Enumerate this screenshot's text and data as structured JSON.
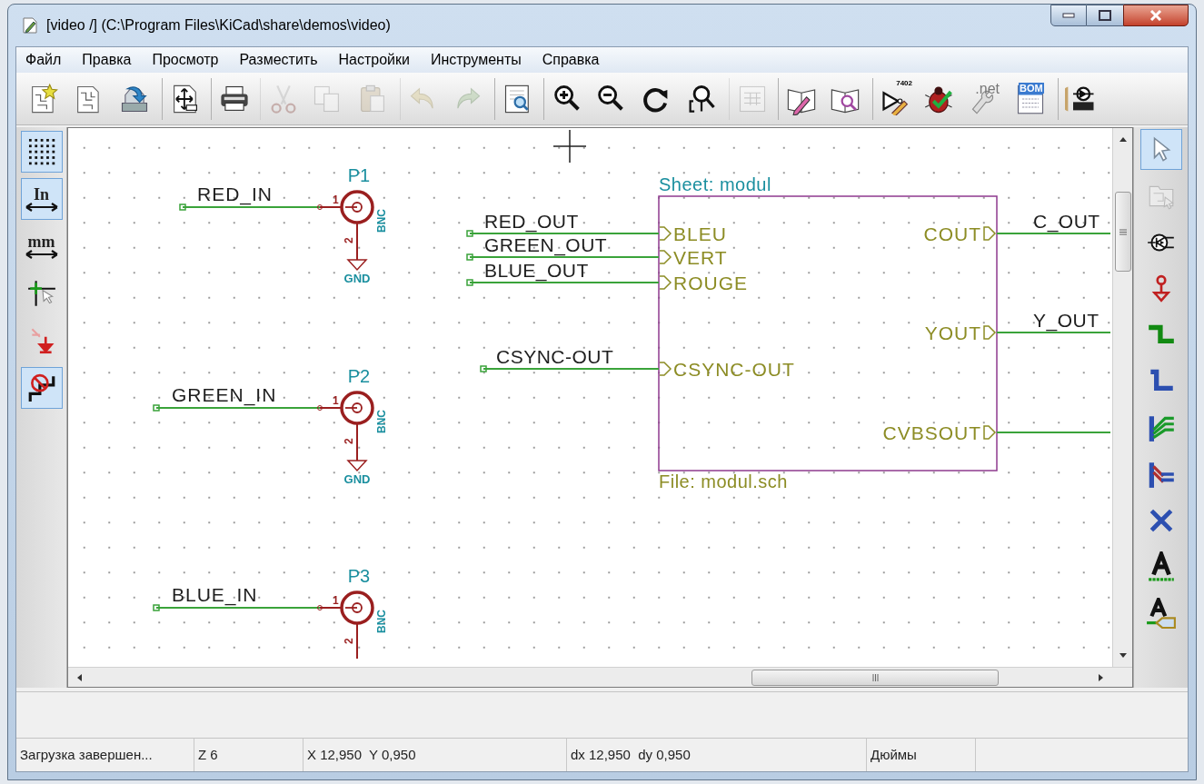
{
  "window": {
    "title": "[video /] (C:\\Program Files\\KiCad\\share\\demos\\video)"
  },
  "menu": [
    "Файл",
    "Правка",
    "Просмотр",
    "Разместить",
    "Настройки",
    "Инструменты",
    "Справка"
  ],
  "toolbar": [
    {
      "kind": "new",
      "disabled": false,
      "separator_before": false
    },
    {
      "kind": "open",
      "disabled": false,
      "separator_before": false
    },
    {
      "kind": "save",
      "disabled": false,
      "separator_before": false
    },
    {
      "kind": "page",
      "disabled": false,
      "separator_before": true
    },
    {
      "kind": "print",
      "disabled": false,
      "separator_before": true
    },
    {
      "kind": "cut",
      "disabled": true,
      "separator_before": true
    },
    {
      "kind": "copy",
      "disabled": true,
      "separator_before": false
    },
    {
      "kind": "paste",
      "disabled": true,
      "separator_before": false
    },
    {
      "kind": "undo",
      "disabled": true,
      "separator_before": true
    },
    {
      "kind": "redo",
      "disabled": true,
      "separator_before": false
    },
    {
      "kind": "preview",
      "disabled": false,
      "separator_before": true
    },
    {
      "kind": "zoom_in",
      "disabled": false,
      "separator_before": true
    },
    {
      "kind": "zoom_out",
      "disabled": false,
      "separator_before": false
    },
    {
      "kind": "redraw",
      "disabled": false,
      "separator_before": false
    },
    {
      "kind": "zoom_fit",
      "disabled": false,
      "separator_before": false
    },
    {
      "kind": "hierarchy",
      "disabled": true,
      "separator_before": true
    },
    {
      "kind": "lib_edit",
      "disabled": false,
      "separator_before": true
    },
    {
      "kind": "lib_browse",
      "disabled": false,
      "separator_before": false
    },
    {
      "kind": "annotate",
      "disabled": false,
      "separator_before": true,
      "text": "7402"
    },
    {
      "kind": "erc",
      "disabled": false,
      "separator_before": false
    },
    {
      "kind": "netlist",
      "disabled": false,
      "separator_before": false,
      "text": ".net"
    },
    {
      "kind": "bom",
      "disabled": false,
      "separator_before": false,
      "text": "BOM"
    },
    {
      "kind": "pcb",
      "disabled": false,
      "separator_before": true
    }
  ],
  "left_toolbar": [
    {
      "kind": "grid",
      "selected": true
    },
    {
      "kind": "units",
      "selected": true,
      "text": "In"
    },
    {
      "kind": "units",
      "selected": false,
      "text": "mm"
    },
    {
      "kind": "cursor",
      "selected": false
    },
    {
      "kind": "pins",
      "selected": false
    },
    {
      "kind": "bus",
      "selected": true
    }
  ],
  "right_toolbar": [
    {
      "kind": "select",
      "selected": true,
      "disabled": false
    },
    {
      "kind": "hier_nav",
      "selected": false,
      "disabled": true
    },
    {
      "kind": "component",
      "selected": false,
      "disabled": false
    },
    {
      "kind": "power",
      "selected": false,
      "disabled": false
    },
    {
      "kind": "wire",
      "selected": false,
      "disabled": false
    },
    {
      "kind": "bus",
      "selected": false,
      "disabled": false
    },
    {
      "kind": "wire_entry",
      "selected": false,
      "disabled": false
    },
    {
      "kind": "bus_entry",
      "selected": false,
      "disabled": false
    },
    {
      "kind": "no_connect",
      "selected": false,
      "disabled": false
    },
    {
      "kind": "label",
      "selected": false,
      "disabled": false
    },
    {
      "kind": "global_label",
      "selected": false,
      "disabled": false
    }
  ],
  "schematic": {
    "connectors": [
      {
        "ref": "P1",
        "net": "RED_IN",
        "pin1": "1",
        "pin2": "2",
        "value": "BNC",
        "power": "GND"
      },
      {
        "ref": "P2",
        "net": "GREEN_IN",
        "pin1": "1",
        "pin2": "2",
        "value": "BNC",
        "power": "GND"
      },
      {
        "ref": "P3",
        "net": "BLUE_IN",
        "pin1": "1",
        "pin2": "2",
        "value": "BNC"
      }
    ],
    "sheet": {
      "name": "Sheet: modul",
      "file": "File: modul.sch",
      "left_pins": [
        {
          "name": "BLEU",
          "net": "RED_OUT"
        },
        {
          "name": "VERT",
          "net": "GREEN_OUT"
        },
        {
          "name": "ROUGE",
          "net": "BLUE_OUT"
        },
        {
          "name": "CSYNC-OUT",
          "net": "CSYNC-OUT"
        }
      ],
      "right_pins": [
        {
          "name": "COUT",
          "net": "C_OUT"
        },
        {
          "name": "YOUT",
          "net": "Y_OUT"
        },
        {
          "name": "CVBSOUT"
        }
      ]
    }
  },
  "status_bar": [
    "Загрузка завершен...",
    "Z 6",
    "X 12,950  Y 0,950",
    "dx 12,950  dy 0,950",
    "Дюймы"
  ]
}
